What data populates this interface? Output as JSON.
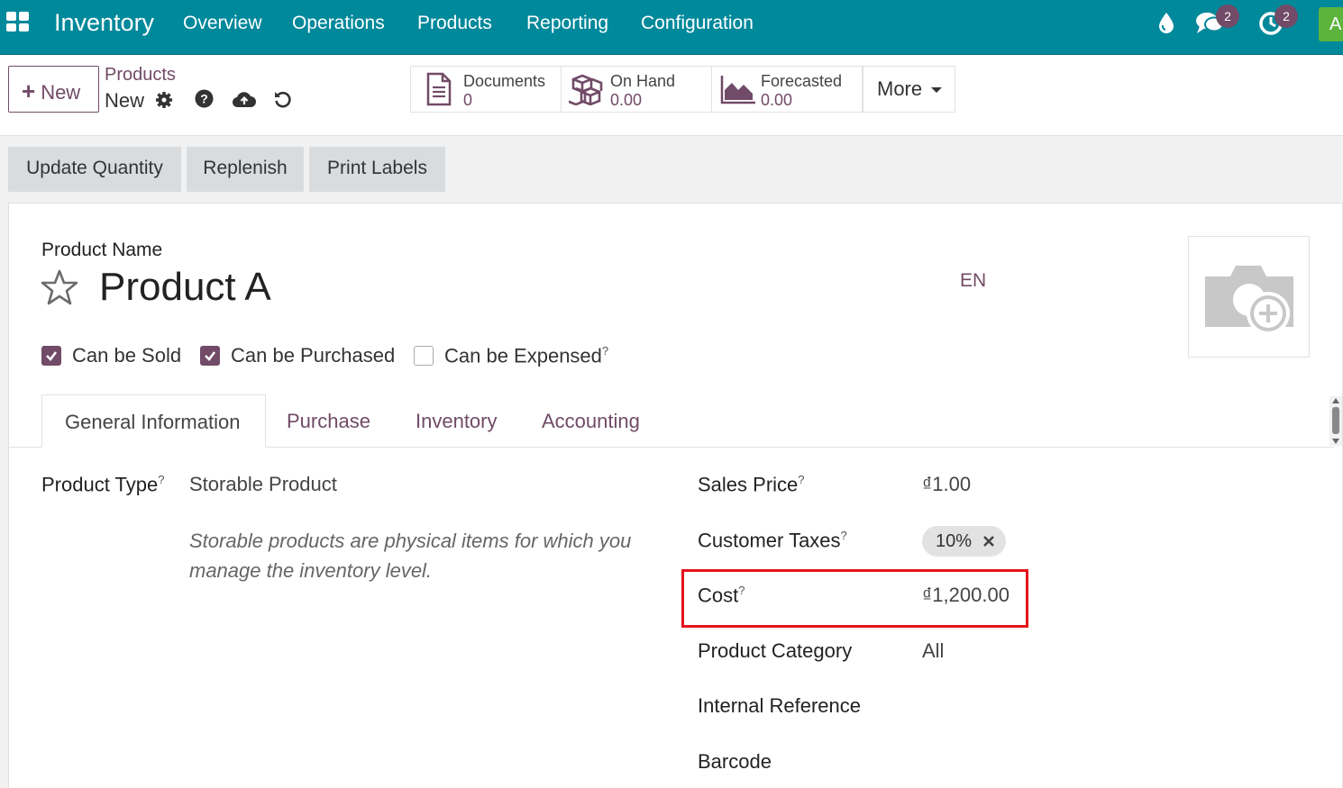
{
  "navbar": {
    "app_name": "Inventory",
    "menu": [
      "Overview",
      "Operations",
      "Products",
      "Reporting",
      "Configuration"
    ],
    "messages_badge": "2",
    "activities_badge": "2",
    "avatar_letter": "A"
  },
  "control_panel": {
    "new_label": "New",
    "breadcrumb_parent": "Products",
    "breadcrumb_current": "New",
    "smart_buttons": [
      {
        "label": "Documents",
        "value": "0",
        "icon": "document-icon"
      },
      {
        "label": "On Hand",
        "value": "0.00",
        "icon": "cubes-icon"
      },
      {
        "label": "Forecasted",
        "value": "0.00",
        "icon": "area-chart-icon"
      }
    ],
    "more_label": "More"
  },
  "actions": [
    "Update Quantity",
    "Replenish",
    "Print Labels"
  ],
  "form": {
    "product_name_label": "Product Name",
    "product_name": "Product A",
    "lang": "EN",
    "checkboxes": [
      {
        "label": "Can be Sold",
        "checked": true
      },
      {
        "label": "Can be Purchased",
        "checked": true
      },
      {
        "label": "Can be Expensed",
        "checked": false
      }
    ],
    "tabs": [
      "General Information",
      "Purchase",
      "Inventory",
      "Accounting"
    ],
    "active_tab": "General Information",
    "product_type_label": "Product Type",
    "product_type_value": "Storable Product",
    "product_type_hint": "Storable products are physical items for which you manage the inventory level.",
    "sales_price_label": "Sales Price",
    "sales_price_value": "₫1.00",
    "customer_taxes_label": "Customer Taxes",
    "customer_taxes_tag": "10%",
    "cost_label": "Cost",
    "cost_value": "₫1,200.00",
    "product_category_label": "Product Category",
    "product_category_value": "All",
    "internal_reference_label": "Internal Reference",
    "barcode_label": "Barcode"
  },
  "colors": {
    "navbar": "#00889b",
    "primary": "#714b67",
    "highlight": "#e3141b"
  }
}
